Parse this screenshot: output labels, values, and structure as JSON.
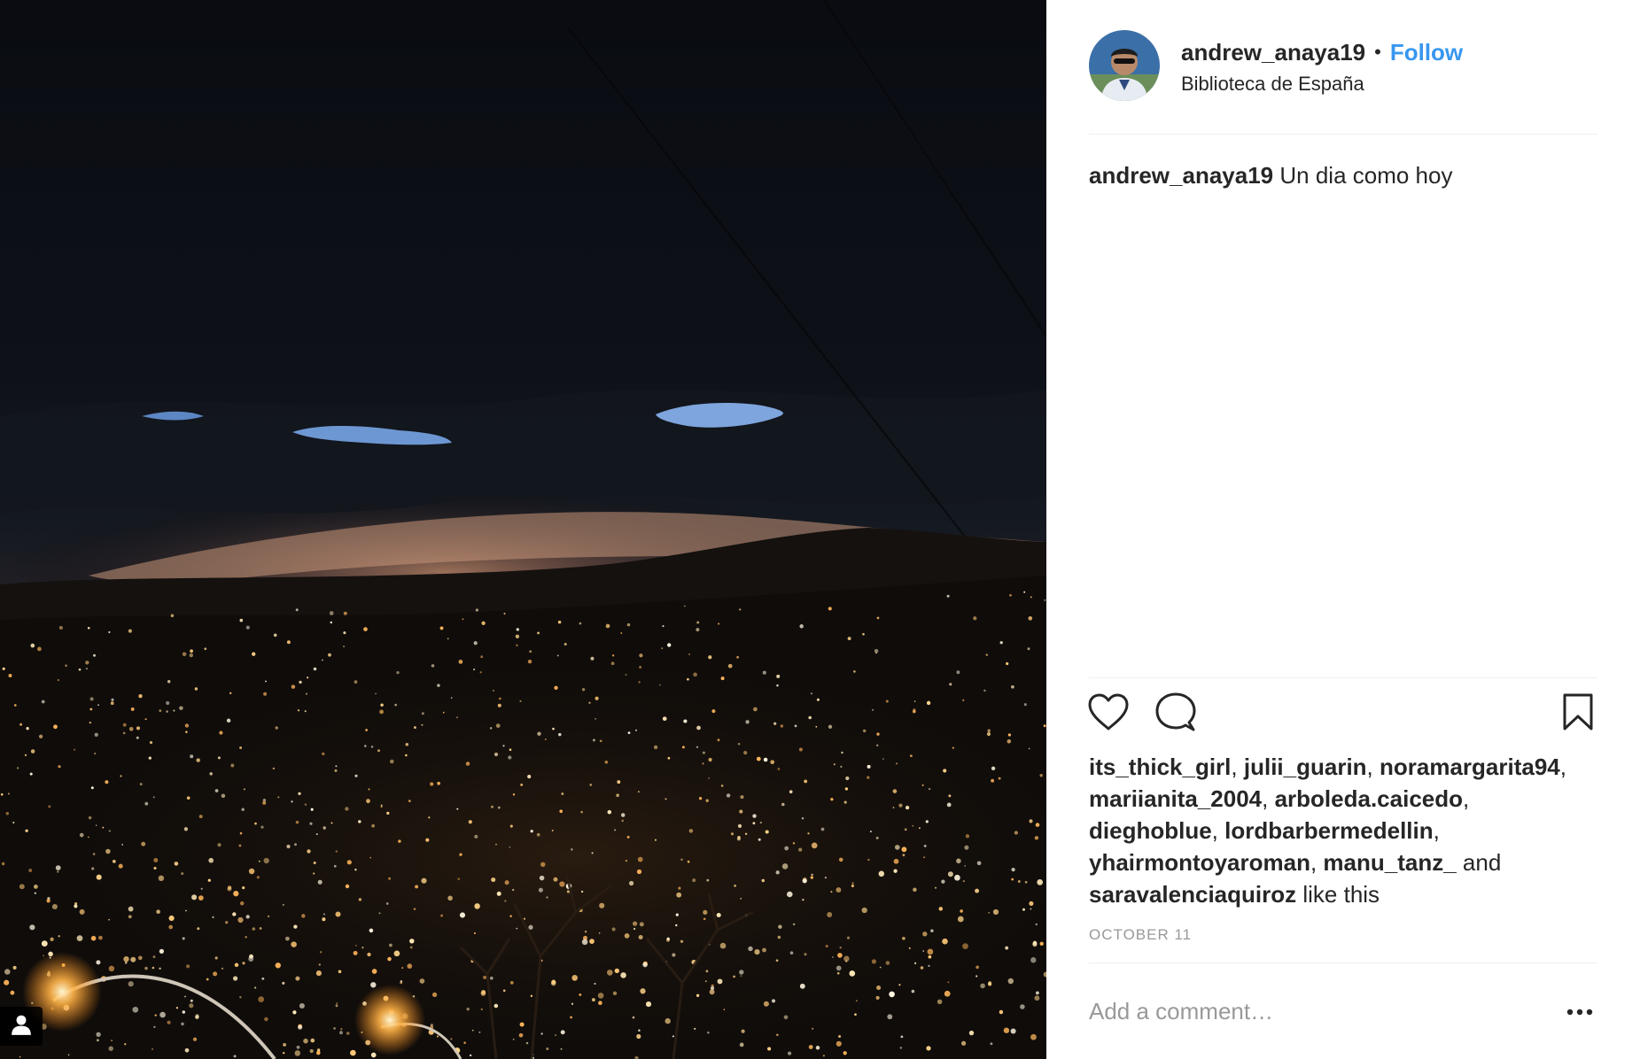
{
  "post": {
    "author": {
      "username": "andrew_anaya19",
      "avatar_icon": "avatar-photo"
    },
    "separator": "•",
    "follow_label": "Follow",
    "location": "Biblioteca de España",
    "caption_text": "Un dia como hoy",
    "likes": {
      "users": [
        "its_thick_girl",
        "julii_guarin",
        "noramargarita94",
        "mariianita_2004",
        "arboleda.caicedo",
        "dieghoblue",
        "lordbarbermedellin",
        "yhairmontoyaroman",
        "manu_tanz_",
        "saravalenciaquiroz"
      ],
      "separator": ", ",
      "and_word": "and",
      "suffix": "like this"
    },
    "timestamp": "October 11",
    "comment_placeholder": "Add a comment…"
  },
  "icons": {
    "like": "heart-icon",
    "comment": "comment-icon",
    "save": "bookmark-icon",
    "more": "more-options-icon",
    "user_tag": "user-tag-icon"
  },
  "colors": {
    "link_blue": "#3897f0",
    "text": "#262626",
    "muted": "#999999",
    "divider": "#efefef"
  }
}
